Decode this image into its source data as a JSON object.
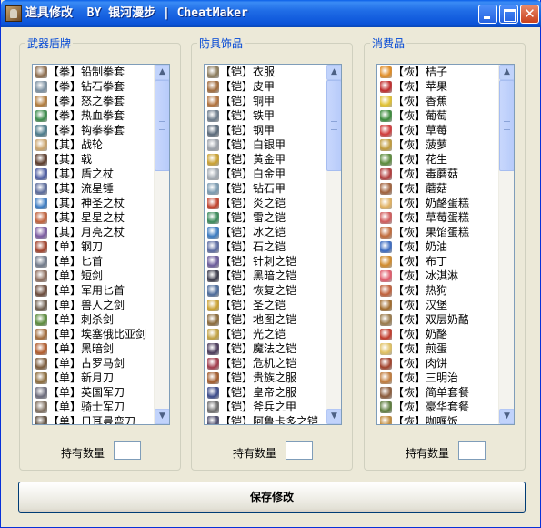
{
  "window": {
    "title": "道具修改  BY 银河漫步 | CheatMaker"
  },
  "groups": [
    {
      "title": "武器盾牌",
      "qty_label": "持有数量",
      "qty_value": "",
      "items": [
        {
          "label": "【拳】铅制拳套",
          "icon": "fist-glove-icon",
          "color": "#8a6a4a"
        },
        {
          "label": "【拳】钻石拳套",
          "icon": "fist-glove-icon",
          "color": "#7a8fa0"
        },
        {
          "label": "【拳】怒之拳套",
          "icon": "fist-glove-icon",
          "color": "#b07a3a"
        },
        {
          "label": "【拳】热血拳套",
          "icon": "fist-glove-icon",
          "color": "#3a8a4a"
        },
        {
          "label": "【拳】钩拳拳套",
          "icon": "fist-glove-icon",
          "color": "#4a7a8a"
        },
        {
          "label": "【其】战轮",
          "icon": "chakram-icon",
          "color": "#c9a36b"
        },
        {
          "label": "【其】戟",
          "icon": "halberd-icon",
          "color": "#5a3a2a"
        },
        {
          "label": "【其】盾之杖",
          "icon": "staff-icon",
          "color": "#4a5aa0"
        },
        {
          "label": "【其】流星锤",
          "icon": "flail-icon",
          "color": "#5a6a9a"
        },
        {
          "label": "【其】神圣之杖",
          "icon": "staff-icon",
          "color": "#3a7ac0"
        },
        {
          "label": "【其】星星之杖",
          "icon": "staff-icon",
          "color": "#c0603a"
        },
        {
          "label": "【其】月亮之杖",
          "icon": "staff-icon",
          "color": "#7a5aa0"
        },
        {
          "label": "【单】钢刀",
          "icon": "crossed-swords-icon",
          "color": "#a0402a"
        },
        {
          "label": "【单】匕首",
          "icon": "dagger-icon",
          "color": "#707a8a"
        },
        {
          "label": "【单】短剑",
          "icon": "sword-icon",
          "color": "#8a6a5a"
        },
        {
          "label": "【单】军用匕首",
          "icon": "dagger-icon",
          "color": "#6a4a3a"
        },
        {
          "label": "【单】兽人之剑",
          "icon": "sword-icon",
          "color": "#6a5a4a"
        },
        {
          "label": "【单】刺杀剑",
          "icon": "sword-icon",
          "color": "#5a8a3a"
        },
        {
          "label": "【单】埃塞俄比亚剑",
          "icon": "sword-icon",
          "color": "#a06a3a"
        },
        {
          "label": "【单】黑暗剑",
          "icon": "sword-icon",
          "color": "#b05a2a"
        },
        {
          "label": "【单】古罗马剑",
          "icon": "sword-icon",
          "color": "#7a5a3a"
        },
        {
          "label": "【单】新月刀",
          "icon": "sword-icon",
          "color": "#8a6a3a"
        },
        {
          "label": "【单】英国军刀",
          "icon": "sword-icon",
          "color": "#6a6a7a"
        },
        {
          "label": "【单】骑士军刀",
          "icon": "sword-icon",
          "color": "#7a6a5a"
        },
        {
          "label": "【单】日耳曼弯刀",
          "icon": "sword-icon",
          "color": "#5a4a3a"
        }
      ]
    },
    {
      "title": "防具饰品",
      "qty_label": "持有数量",
      "qty_value": "",
      "items": [
        {
          "label": "【铠】衣服",
          "icon": "clothes-icon",
          "color": "#8a7a5a"
        },
        {
          "label": "【铠】皮甲",
          "icon": "leather-armor-icon",
          "color": "#a06a3a"
        },
        {
          "label": "【铠】铜甲",
          "icon": "armor-icon",
          "color": "#b0703a"
        },
        {
          "label": "【铠】铁甲",
          "icon": "armor-icon",
          "color": "#6a7a8a"
        },
        {
          "label": "【铠】钢甲",
          "icon": "armor-icon",
          "color": "#5a6a7a"
        },
        {
          "label": "【铠】白银甲",
          "icon": "armor-icon",
          "color": "#9aa0a8"
        },
        {
          "label": "【铠】黄金甲",
          "icon": "armor-icon",
          "color": "#c9a030"
        },
        {
          "label": "【铠】白金甲",
          "icon": "armor-icon",
          "color": "#a0a8b0"
        },
        {
          "label": "【铠】钻石甲",
          "icon": "armor-icon",
          "color": "#7a9ab0"
        },
        {
          "label": "【铠】炎之铠",
          "icon": "armor-icon",
          "color": "#c0402a"
        },
        {
          "label": "【铠】雷之铠",
          "icon": "armor-icon",
          "color": "#3a8a5a"
        },
        {
          "label": "【铠】冰之铠",
          "icon": "armor-icon",
          "color": "#3a7ac0"
        },
        {
          "label": "【铠】石之铠",
          "icon": "armor-icon",
          "color": "#5a6aa0"
        },
        {
          "label": "【铠】针刺之铠",
          "icon": "armor-icon",
          "color": "#6a5a9a"
        },
        {
          "label": "【铠】黑暗之铠",
          "icon": "armor-icon",
          "color": "#3a3a4a"
        },
        {
          "label": "【铠】恢复之铠",
          "icon": "armor-icon",
          "color": "#4a6a9a"
        },
        {
          "label": "【铠】圣之铠",
          "icon": "armor-icon",
          "color": "#c9a030"
        },
        {
          "label": "【铠】地图之铠",
          "icon": "armor-icon",
          "color": "#8a6a3a"
        },
        {
          "label": "【铠】光之铠",
          "icon": "armor-icon",
          "color": "#c0a040"
        },
        {
          "label": "【铠】魔法之铠",
          "icon": "armor-icon",
          "color": "#4a3a5a"
        },
        {
          "label": "【铠】危机之铠",
          "icon": "armor-icon",
          "color": "#a03a4a"
        },
        {
          "label": "【铠】贵族之服",
          "icon": "robe-icon",
          "color": "#a05a2a"
        },
        {
          "label": "【铠】皇帝之服",
          "icon": "robe-icon",
          "color": "#3a4a8a"
        },
        {
          "label": "【铠】斧兵之甲",
          "icon": "armor-icon",
          "color": "#6a6a6a"
        },
        {
          "label": "【铠】阿鲁卡多之铠",
          "icon": "armor-icon",
          "color": "#4a4a6a"
        }
      ]
    },
    {
      "title": "消费品",
      "qty_label": "持有数量",
      "qty_value": "",
      "items": [
        {
          "label": "【恢】桔子",
          "icon": "orange-icon",
          "color": "#e08a20"
        },
        {
          "label": "【恢】苹果",
          "icon": "apple-icon",
          "color": "#c02a2a"
        },
        {
          "label": "【恢】香蕉",
          "icon": "banana-icon",
          "color": "#e0c030"
        },
        {
          "label": "【恢】葡萄",
          "icon": "grapes-icon",
          "color": "#3a8a3a"
        },
        {
          "label": "【恢】草莓",
          "icon": "strawberry-icon",
          "color": "#d03a3a"
        },
        {
          "label": "【恢】菠萝",
          "icon": "pineapple-icon",
          "color": "#c09a3a"
        },
        {
          "label": "【恢】花生",
          "icon": "peanut-icon",
          "color": "#5a8a3a"
        },
        {
          "label": "【恢】毒蘑菇",
          "icon": "poison-mushroom-icon",
          "color": "#b03a3a"
        },
        {
          "label": "【恢】蘑菇",
          "icon": "mushroom-icon",
          "color": "#a0603a"
        },
        {
          "label": "【恢】奶酪蛋糕",
          "icon": "cheesecake-icon",
          "color": "#e0b060"
        },
        {
          "label": "【恢】草莓蛋糕",
          "icon": "strawberry-cake-icon",
          "color": "#d05a5a"
        },
        {
          "label": "【恢】果馅蛋糕",
          "icon": "fruit-cake-icon",
          "color": "#c06a3a"
        },
        {
          "label": "【恢】奶油",
          "icon": "cream-icon",
          "color": "#3a6ac0"
        },
        {
          "label": "【恢】布丁",
          "icon": "pudding-icon",
          "color": "#d08a2a"
        },
        {
          "label": "【恢】冰淇淋",
          "icon": "ice-cream-icon",
          "color": "#e05a6a"
        },
        {
          "label": "【恢】热狗",
          "icon": "hot-dog-icon",
          "color": "#c0603a"
        },
        {
          "label": "【恢】汉堡",
          "icon": "hamburger-icon",
          "color": "#a06a2a"
        },
        {
          "label": "【恢】双层奶酪",
          "icon": "cheese-icon",
          "color": "#9a7a4a"
        },
        {
          "label": "【恢】奶酪",
          "icon": "cheese-icon",
          "color": "#c03a2a"
        },
        {
          "label": "【恢】煎蛋",
          "icon": "fried-egg-icon",
          "color": "#e0c060"
        },
        {
          "label": "【恢】肉饼",
          "icon": "meat-pie-icon",
          "color": "#a0402a"
        },
        {
          "label": "【恢】三明治",
          "icon": "sandwich-icon",
          "color": "#c07a3a"
        },
        {
          "label": "【恢】简单套餐",
          "icon": "meal-icon",
          "color": "#8a5a3a"
        },
        {
          "label": "【恢】豪华套餐",
          "icon": "meal-icon",
          "color": "#5a7a3a"
        },
        {
          "label": "【恢】咖喱饭",
          "icon": "curry-rice-icon",
          "color": "#c08a3a"
        }
      ]
    }
  ],
  "save_button": {
    "label": "保存修改"
  }
}
